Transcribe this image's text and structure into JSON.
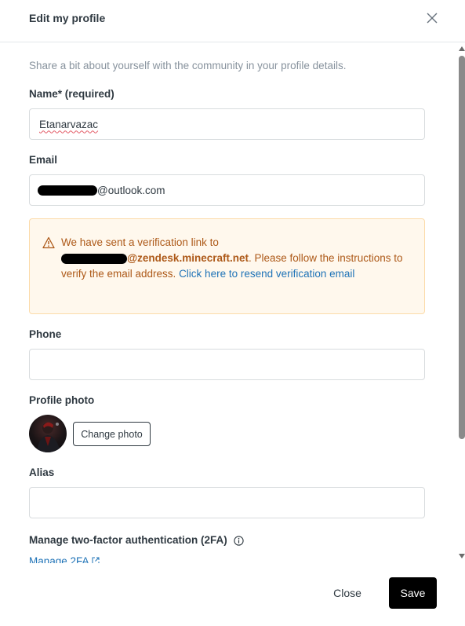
{
  "modal": {
    "title": "Edit my profile"
  },
  "form": {
    "intro": "Share a bit about yourself with the community in your profile details.",
    "name": {
      "label": "Name* (required)",
      "value": "Etanarvazac"
    },
    "email": {
      "label": "Email",
      "value_suffix": "@outlook.com"
    },
    "alert": {
      "line1": "We have sent a verification link to",
      "domain": "@zendesk.minecraft.net",
      "text2": ". Please follow the instructions to verify the email address. ",
      "link": "Click here to resend verification email"
    },
    "phone": {
      "label": "Phone",
      "value": ""
    },
    "profile_photo": {
      "label": "Profile photo",
      "button": "Change photo"
    },
    "alias": {
      "label": "Alias",
      "value": ""
    },
    "two_fa": {
      "label": "Manage two-factor authentication (2FA)",
      "link": "Manage 2FA"
    }
  },
  "footer": {
    "close": "Close",
    "save": "Save"
  },
  "colors": {
    "alert_bg": "#fff8ed",
    "alert_border": "#fcdba9",
    "alert_text": "#ad5918",
    "link": "#1f73b7",
    "primary_button": "#000000"
  }
}
